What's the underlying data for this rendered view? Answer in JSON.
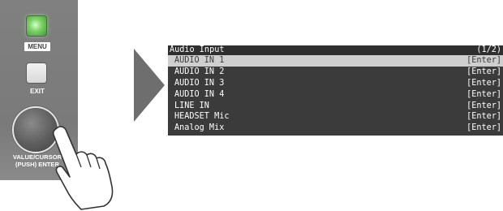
{
  "device": {
    "menu_label": "MENU",
    "exit_label": "EXIT",
    "knob_label_line1": "VALUE/CURSOR",
    "knob_label_line2": "(PUSH) ENTER",
    "menu_led_color": "#7fd36a"
  },
  "screen": {
    "title": "Audio Input",
    "page_indicator": "(1/2)",
    "items": [
      {
        "label": "AUDIO IN 1",
        "action": "[Enter]",
        "selected": true
      },
      {
        "label": "AUDIO IN 2",
        "action": "[Enter]",
        "selected": false
      },
      {
        "label": "AUDIO IN 3",
        "action": "[Enter]",
        "selected": false
      },
      {
        "label": "AUDIO IN 4",
        "action": "[Enter]",
        "selected": false
      },
      {
        "label": "LINE IN",
        "action": "[Enter]",
        "selected": false
      },
      {
        "label": "HEADSET Mic",
        "action": "[Enter]",
        "selected": false
      },
      {
        "label": "Analog Mix",
        "action": "[Enter]",
        "selected": false
      }
    ]
  },
  "icons": {
    "arrow": "chevron-right-icon",
    "hand": "pointing-hand-icon"
  }
}
